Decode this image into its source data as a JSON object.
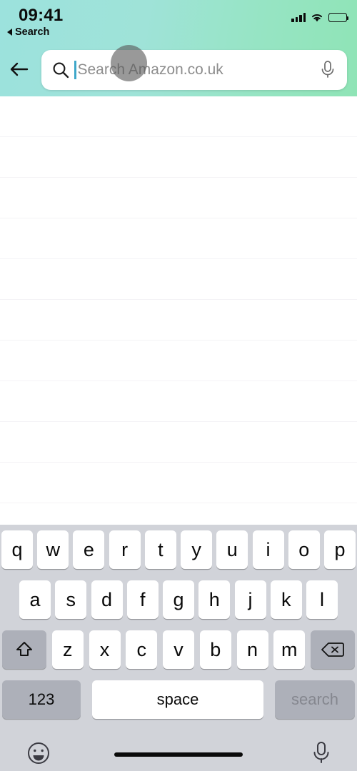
{
  "status_bar": {
    "time": "09:41",
    "back_label": "Search",
    "signal_icon": "cellular-bars-icon",
    "wifi_icon": "wifi-icon",
    "battery_icon": "battery-full-icon"
  },
  "header": {
    "back_arrow_icon": "arrow-left-icon",
    "gradient_start": "#9ce2dd",
    "gradient_end": "#8fe4b6"
  },
  "search": {
    "placeholder": "Search Amazon.co.uk",
    "value": "",
    "glass_icon": "search-icon",
    "mic_icon": "microphone-icon",
    "caret_color": "#3fa7c9"
  },
  "touch_indicator": {
    "name": "touch-point-indicator",
    "color": "rgba(90,90,90,.62)"
  },
  "suggestions": {
    "rows": [
      "",
      "",
      "",
      "",
      "",
      "",
      "",
      "",
      "",
      ""
    ]
  },
  "keyboard": {
    "row1": [
      "q",
      "w",
      "e",
      "r",
      "t",
      "y",
      "u",
      "i",
      "o",
      "p"
    ],
    "row2": [
      "a",
      "s",
      "d",
      "f",
      "g",
      "h",
      "j",
      "k",
      "l"
    ],
    "row3_letters": [
      "z",
      "x",
      "c",
      "v",
      "b",
      "n",
      "m"
    ],
    "shift_icon": "shift-arrow-icon",
    "delete_icon": "backspace-icon",
    "numbers_label": "123",
    "space_label": "space",
    "search_label": "search",
    "background": "#d1d3d9",
    "key_background": "#ffffff",
    "fn_key_background": "#adb0b9"
  },
  "accessory_bar": {
    "emoji_icon": "emoji-smiley-icon",
    "dictation_icon": "microphone-icon",
    "home_indicator": "home-indicator-bar"
  }
}
